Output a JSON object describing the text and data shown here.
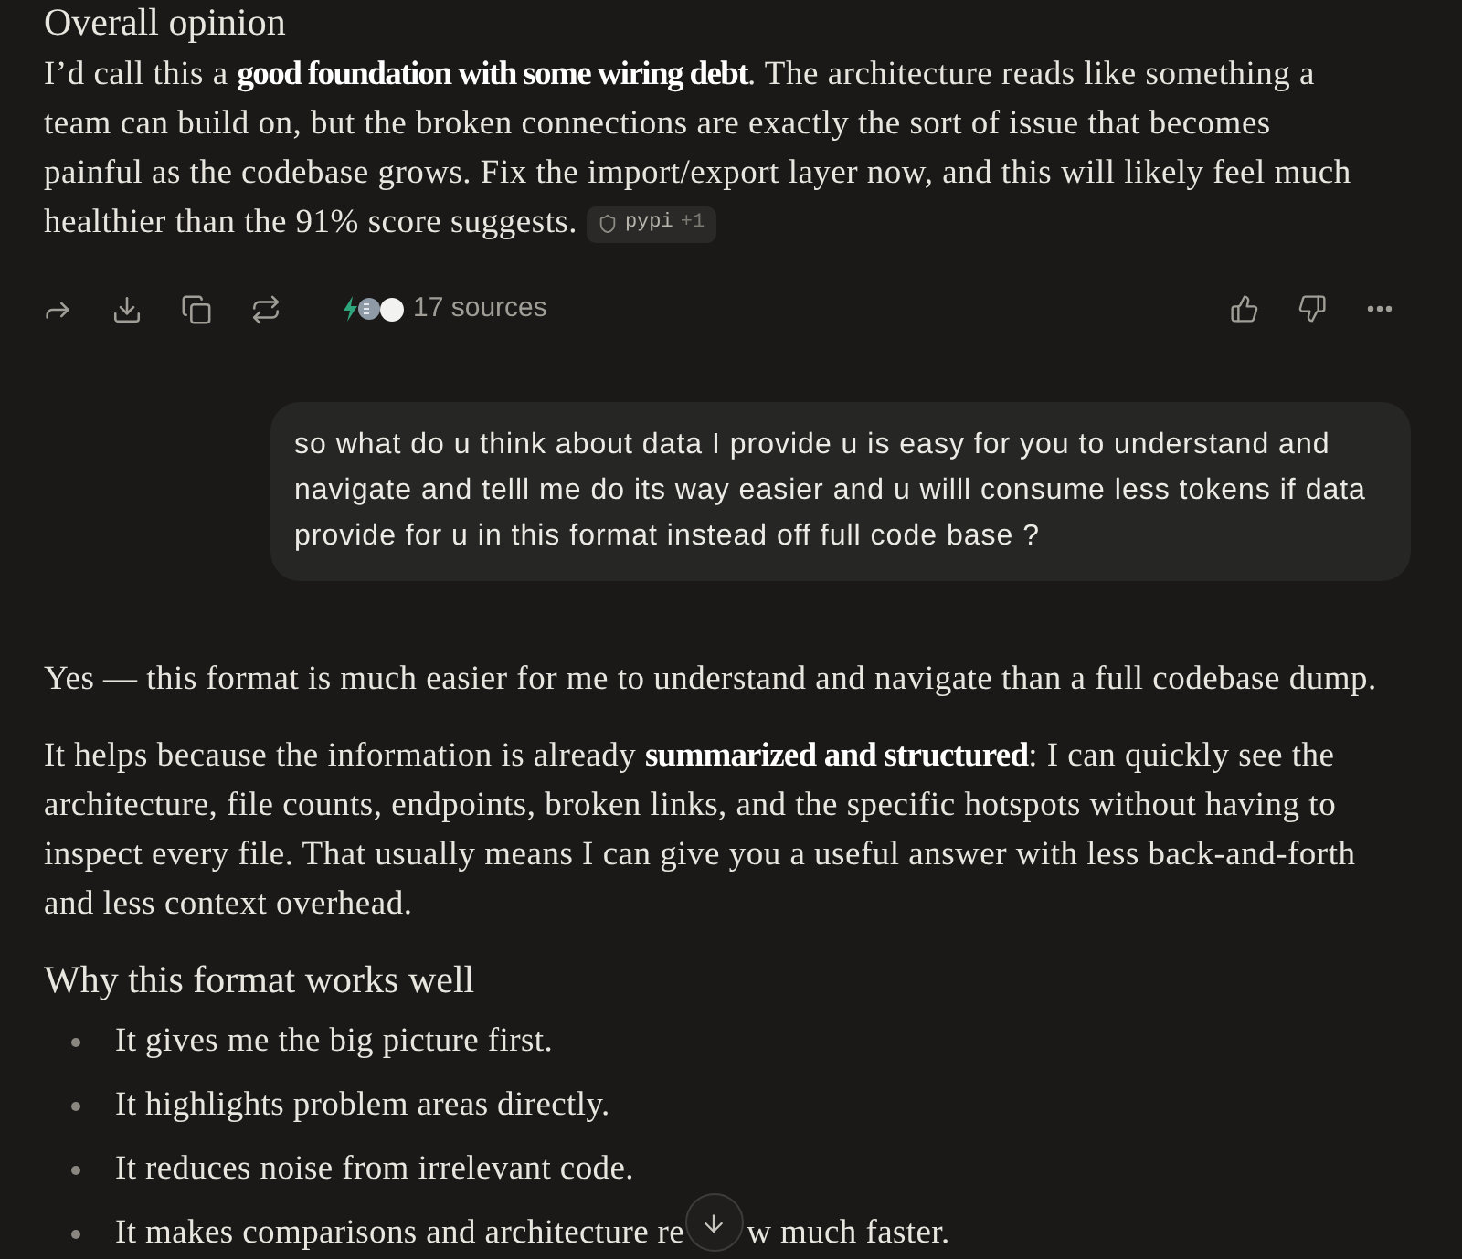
{
  "overall_opinion": {
    "heading": "Overall opinion",
    "paragraph": "I’d call this a **good foundation with some wiring debt**. The architecture reads like something a team can build on, but the broken connections are exactly the sort of issue that becomes painful as the codebase grows. Fix the import/export layer now, and this will likely feel much healthier than the 91% score suggests.",
    "citation": {
      "label": "pypi",
      "more": "+1"
    }
  },
  "message_actions": {
    "sources": "17 sources"
  },
  "user_message": {
    "text": "so what do u think about data I provide u is easy for you to understand and navigate and telll me do its way easier and u willl consume less tokens if data provide for u in this format instead off full code base ?"
  },
  "response": {
    "lead": "Yes — this format is much easier for me to understand and navigate than a full codebase dump.",
    "paragraph": "It helps because the information is already **summarized and structured**: I can quickly see the architecture, file counts, endpoints, broken links, and the specific hotspots without having to inspect every file. That usually means I can give you a useful answer with less back-and-forth and less context overhead.",
    "heading": "Why this format works well",
    "bullets": [
      {
        "parts": [
          "It gives me the big picture first."
        ]
      },
      {
        "parts": [
          "It highlights problem areas directly."
        ]
      },
      {
        "parts": [
          "It reduces noise from irrelevant code."
        ]
      },
      {
        "parts": [
          "It makes comparisons and architecture re",
          "w much faster."
        ]
      }
    ]
  }
}
